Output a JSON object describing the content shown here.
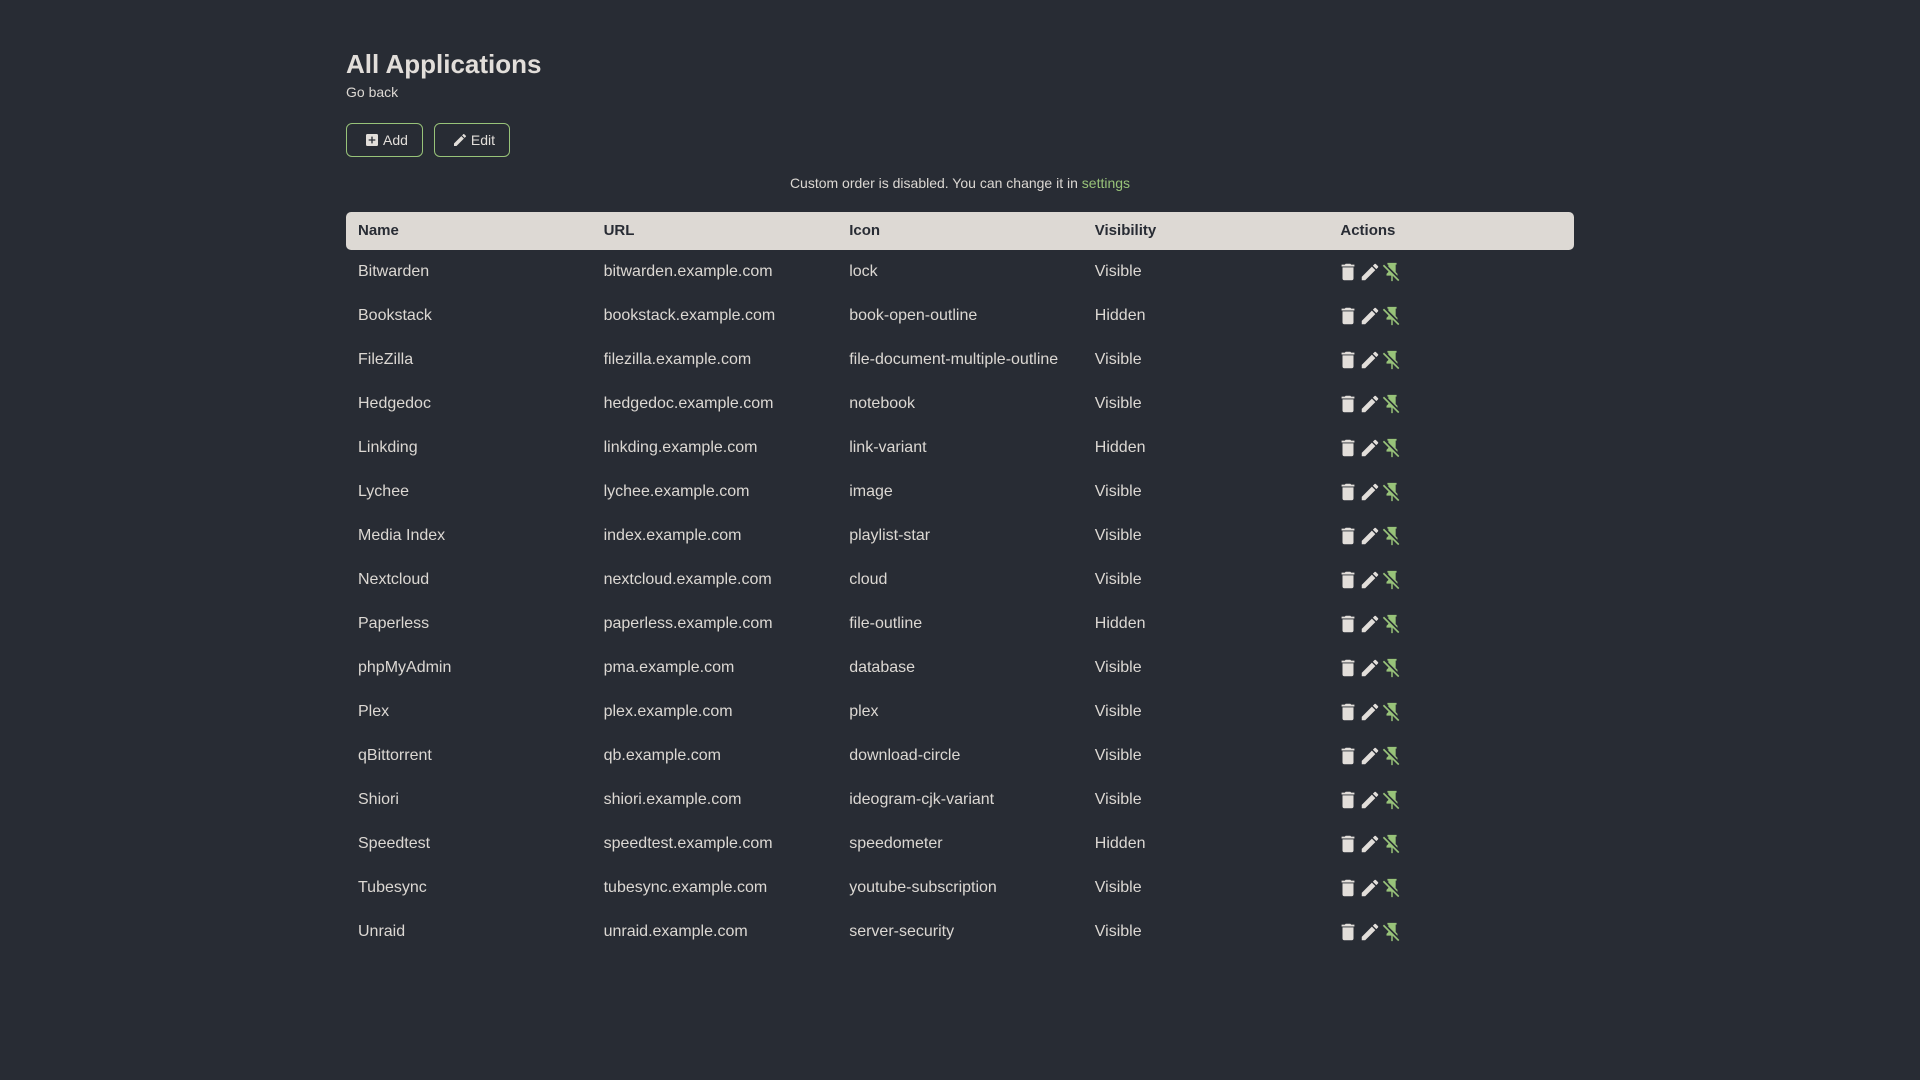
{
  "page": {
    "title": "All Applications",
    "go_back_label": "Go back",
    "background_color": "#282c34",
    "primary_color": "#dcd8d3",
    "accent_color": "#98c379"
  },
  "toolbar": {
    "add_label": "Add",
    "edit_label": "Edit",
    "add_icon": "plus-box",
    "edit_icon": "pencil"
  },
  "notice": {
    "text": "Custom order is disabled. You can change it in",
    "link_label": "settings"
  },
  "table": {
    "columns": [
      "Name",
      "URL",
      "Icon",
      "Visibility",
      "Actions"
    ],
    "row_action_icons": [
      "delete",
      "pencil",
      "pin-off"
    ],
    "rows": [
      {
        "name": "Bitwarden",
        "url": "bitwarden.example.com",
        "icon": "lock",
        "visibility": "Visible"
      },
      {
        "name": "Bookstack",
        "url": "bookstack.example.com",
        "icon": "book-open-outline",
        "visibility": "Hidden"
      },
      {
        "name": "FileZilla",
        "url": "filezilla.example.com",
        "icon": "file-document-multiple-outline",
        "visibility": "Visible"
      },
      {
        "name": "Hedgedoc",
        "url": "hedgedoc.example.com",
        "icon": "notebook",
        "visibility": "Visible"
      },
      {
        "name": "Linkding",
        "url": "linkding.example.com",
        "icon": "link-variant",
        "visibility": "Hidden"
      },
      {
        "name": "Lychee",
        "url": "lychee.example.com",
        "icon": "image",
        "visibility": "Visible"
      },
      {
        "name": "Media Index",
        "url": "index.example.com",
        "icon": "playlist-star",
        "visibility": "Visible"
      },
      {
        "name": "Nextcloud",
        "url": "nextcloud.example.com",
        "icon": "cloud",
        "visibility": "Visible"
      },
      {
        "name": "Paperless",
        "url": "paperless.example.com",
        "icon": "file-outline",
        "visibility": "Hidden"
      },
      {
        "name": "phpMyAdmin",
        "url": "pma.example.com",
        "icon": "database",
        "visibility": "Visible"
      },
      {
        "name": "Plex",
        "url": "plex.example.com",
        "icon": "plex",
        "visibility": "Visible"
      },
      {
        "name": "qBittorrent",
        "url": "qb.example.com",
        "icon": "download-circle",
        "visibility": "Visible"
      },
      {
        "name": "Shiori",
        "url": "shiori.example.com",
        "icon": "ideogram-cjk-variant",
        "visibility": "Visible"
      },
      {
        "name": "Speedtest",
        "url": "speedtest.example.com",
        "icon": "speedometer",
        "visibility": "Hidden"
      },
      {
        "name": "Tubesync",
        "url": "tubesync.example.com",
        "icon": "youtube-subscription",
        "visibility": "Visible"
      },
      {
        "name": "Unraid",
        "url": "unraid.example.com",
        "icon": "server-security",
        "visibility": "Visible"
      }
    ]
  }
}
